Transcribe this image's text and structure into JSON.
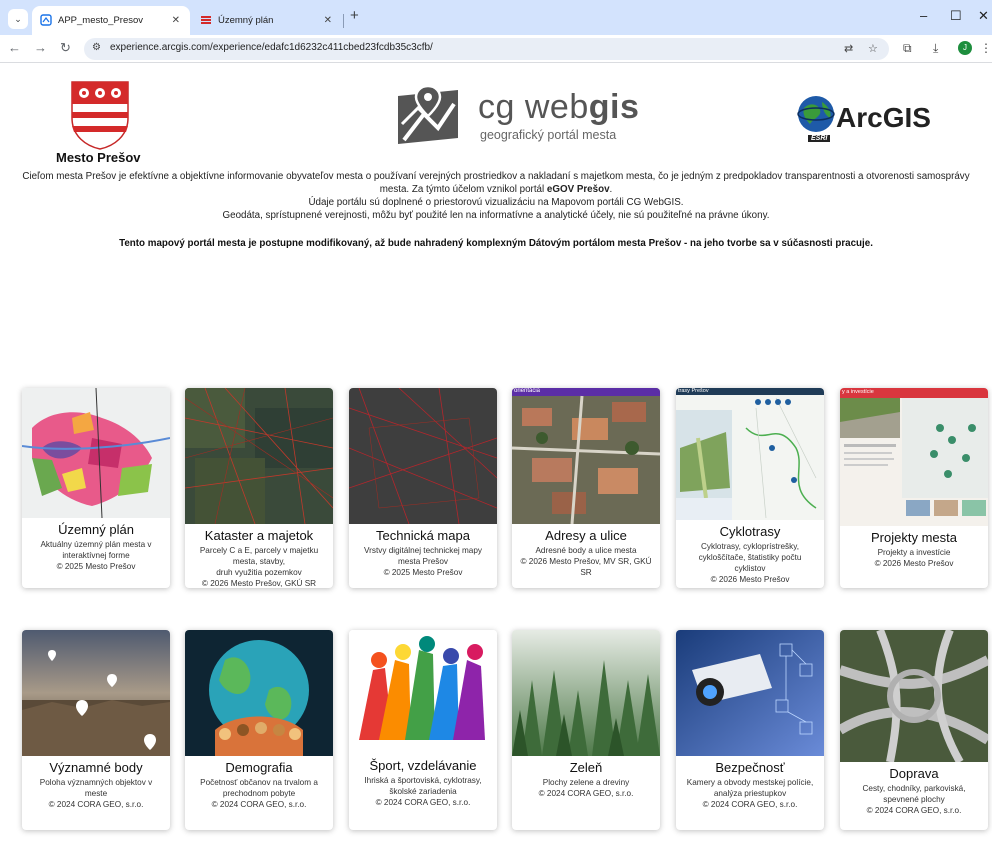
{
  "browser": {
    "tabs": [
      {
        "label": "APP_mesto_Presov",
        "active": true
      },
      {
        "label": "Územný plán",
        "active": false
      }
    ],
    "url": "experience.arcgis.com/experience/edafc1d6232c411cbed23fcdb35c3cfb/",
    "profile_initial": "J"
  },
  "header": {
    "city_name": "Mesto Prešov",
    "cg_title_light": "cg web",
    "cg_title_bold": "gis",
    "cg_subtitle": "geografický portál mesta",
    "arcgis_label": "ArcGIS",
    "esri_label": "ESRI"
  },
  "intro": {
    "line1": "Cieľom mesta Prešov je efektívne a objektívne informovanie obyvateľov mesta o používaní verejných prostriedkov a nakladaní s majetkom mesta, čo je jedným z predpokladov transparentnosti a otvorenosti samosprávy mesta.  Za týmto účelom vznikol portál ",
    "line1_bold": "eGOV Prešov",
    "line2": "Údaje portálu sú doplnené o priestorovú vizualizáciu na Mapovom portáli CG WebGIS.",
    "line3": "Geodáta, sprístupnené verejnosti, môžu byť použité len na informatívne a analytické účely, nie sú použiteľné na právne úkony.",
    "notice": "Tento mapový portál mesta je postupne modifikovaný, až bude nahradený komplexným Dátovým portálom mesta Prešov - na jeho tvorbe sa v súčasnosti pracuje."
  },
  "cards": [
    {
      "title": "Územný plán",
      "desc": "Aktuálny územný plán mesta v interaktívnej forme\n© 2025 Mesto Prešov"
    },
    {
      "title": "Kataster a majetok",
      "desc": "Parcely C a E, parcely v majetku mesta, stavby,\ndruh využitia pozemkov\n© 2026 Mesto Prešov, GKÚ SR"
    },
    {
      "title": "Technická mapa",
      "desc": "Vrstvy digitálnej technickej mapy mesta Prešov\n© 2025 Mesto Prešov"
    },
    {
      "title": "Adresy a ulice",
      "desc": "Adresné body a ulice mesta\n© 2026 Mesto Prešov, MV SR, GKÚ SR"
    },
    {
      "title": "Cyklotrasy",
      "desc": "Cyklotrasy, cykloprístrešky, cykloščítače, štatistiky počtu cyklistov\n© 2026 Mesto Prešov"
    },
    {
      "title": "Projekty mesta",
      "desc": "Projekty a investície\n© 2026 Mesto Prešov"
    },
    {
      "title": "Významné body",
      "desc": "Poloha významných objektov v meste\n© 2024 CORA GEO, s.r.o."
    },
    {
      "title": "Demografia",
      "desc": "Početnosť občanov na trvalom a prechodnom pobyte\n© 2024 CORA GEO, s.r.o."
    },
    {
      "title": "Šport, vzdelávanie",
      "desc": "Ihriská a športoviská, cyklotrasy, školské zariadenia\n© 2024 CORA GEO, s.r.o."
    },
    {
      "title": "Zeleň",
      "desc": "Plochy zelene a dreviny\n© 2024 CORA GEO, s.r.o."
    },
    {
      "title": "Bezpečnosť",
      "desc": "Kamery a obvody mestskej polície, analýza priestupkov\n© 2024 CORA GEO, s.r.o."
    },
    {
      "title": "Doprava",
      "desc": "Cesty, chodníky, parkoviská, spevnené plochy\n© 2024 CORA GEO, s.r.o."
    }
  ],
  "card_overlays": {
    "adresy_bar": "orientácia",
    "cyklo_bar": "trasy Prešov",
    "projekty_bar": "y a investície"
  },
  "colors": {
    "tab_strip": "#d3e3fd",
    "presov_red": "#d42a2a",
    "adresy_bar": "#5b2ea6",
    "cyklo_bar": "#1f3b57",
    "projekty_bar": "#d9363e"
  }
}
